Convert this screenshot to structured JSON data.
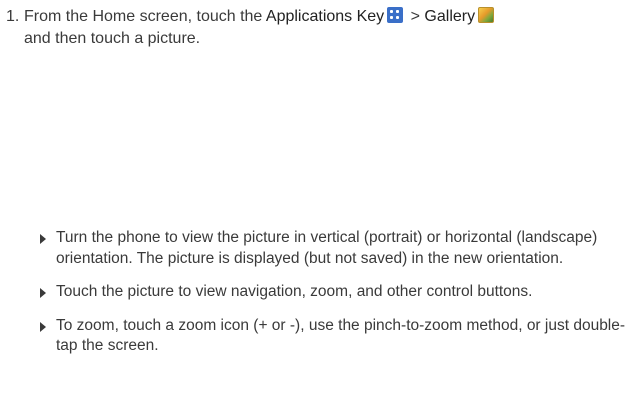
{
  "step": {
    "number": "1.",
    "text_before": "From the Home screen, touch the ",
    "apps_key_label": "Applications Key",
    "separator": " > ",
    "gallery_label": "Gallery",
    "line2": "and then touch a picture."
  },
  "icons": {
    "apps": "applications-grid-icon",
    "gallery": "gallery-photo-icon",
    "apps_color": "#3a6fc8"
  },
  "bullets": [
    "Turn the phone to view the picture in vertical (portrait) or horizontal (landscape) orientation. The picture is displayed (but not saved) in the new orientation.",
    "Touch the picture to view navigation, zoom, and other control buttons.",
    "To zoom, touch a zoom icon (+ or -), use the pinch-to-zoom method, or just double-tap the screen."
  ]
}
